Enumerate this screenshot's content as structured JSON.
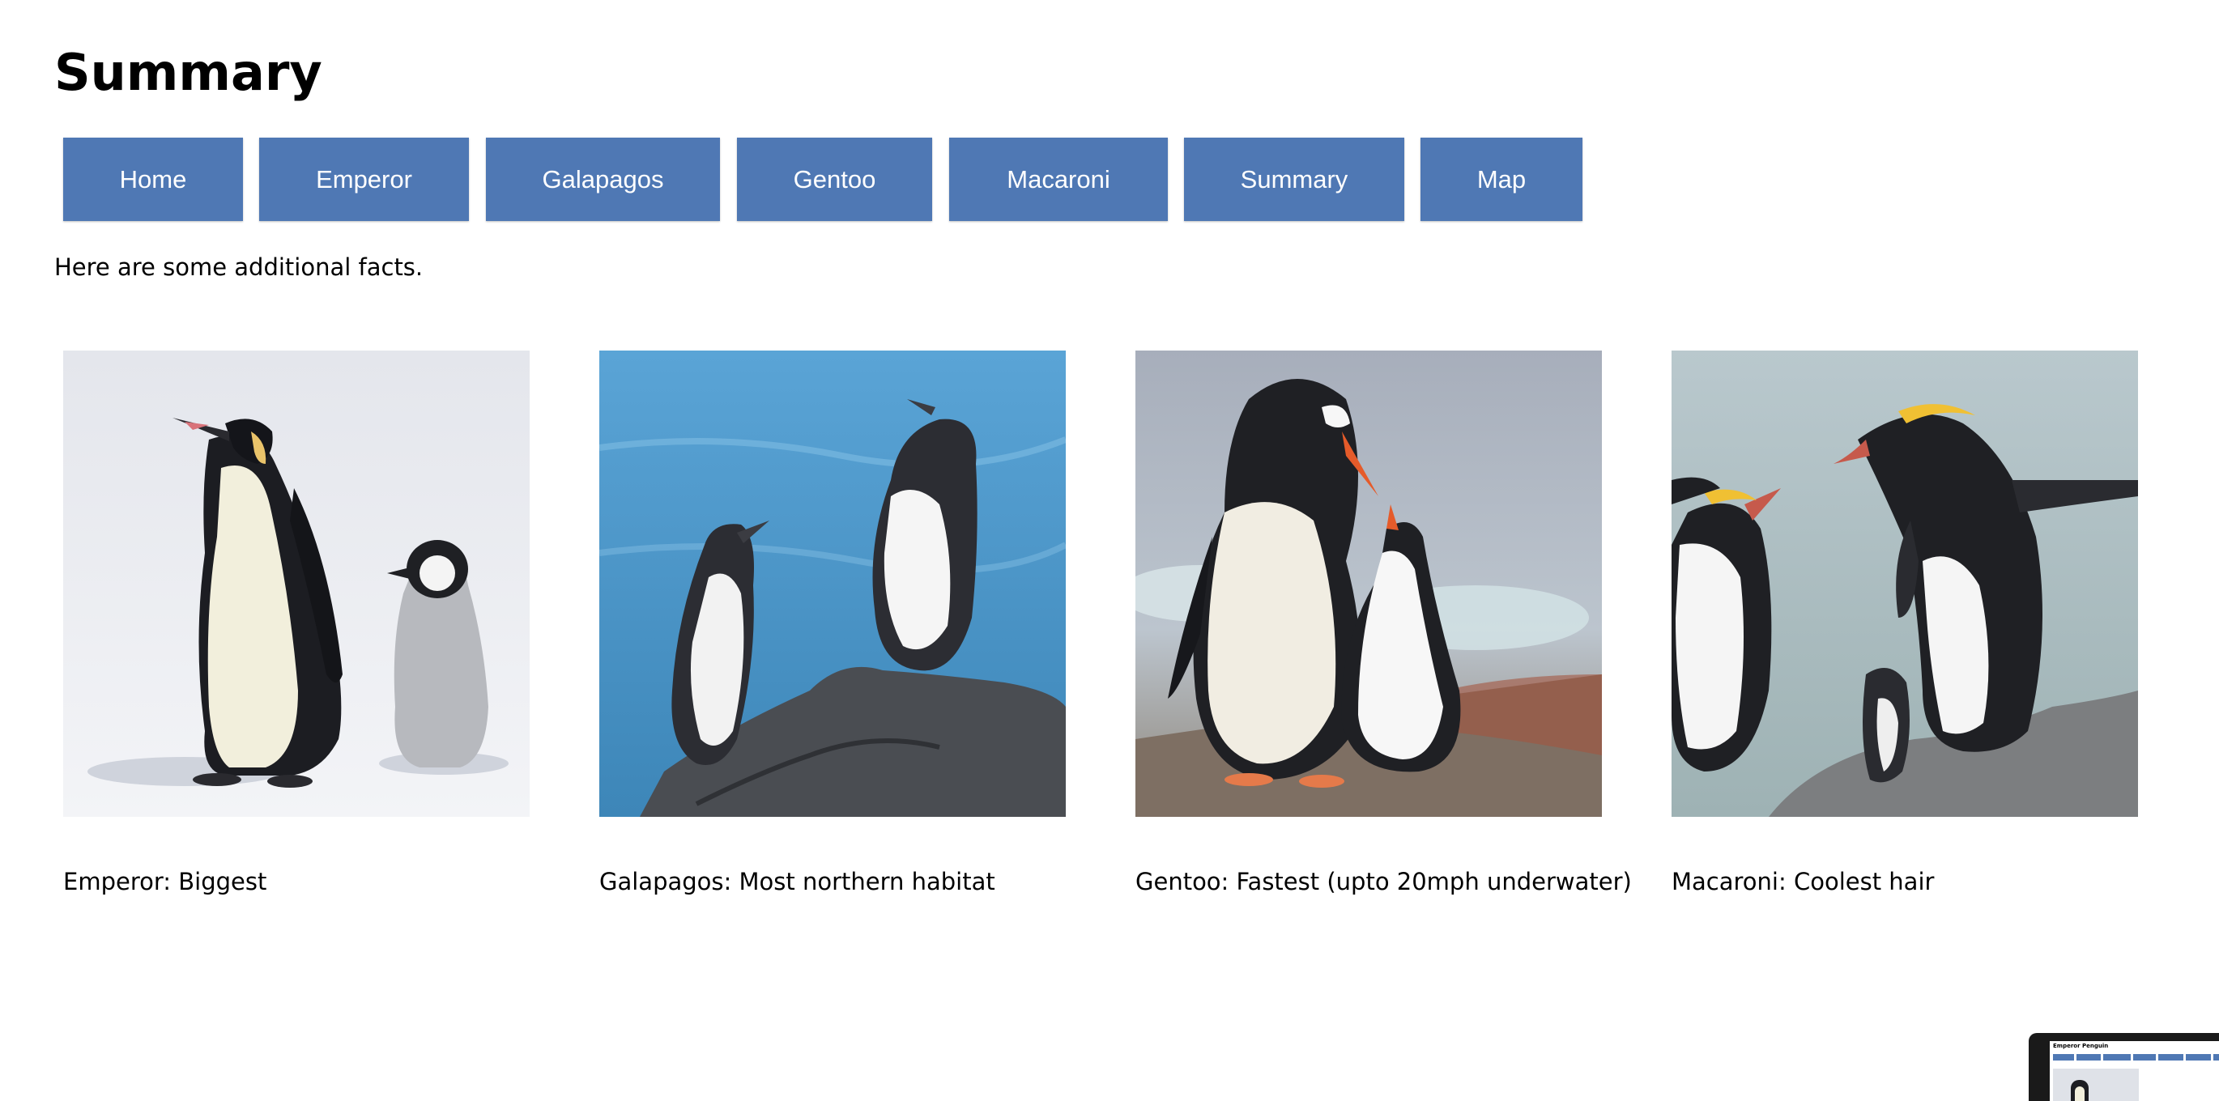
{
  "page": {
    "title": "Summary",
    "intro": "Here are some additional facts."
  },
  "nav": {
    "items": [
      {
        "label": "Home"
      },
      {
        "label": "Emperor"
      },
      {
        "label": "Galapagos"
      },
      {
        "label": "Gentoo"
      },
      {
        "label": "Macaroni"
      },
      {
        "label": "Summary"
      },
      {
        "label": "Map"
      }
    ]
  },
  "facts": [
    {
      "caption": "Emperor: Biggest"
    },
    {
      "caption": "Galapagos: Most northern habitat"
    },
    {
      "caption": "Gentoo: Fastest (upto 20mph underwater)"
    },
    {
      "caption": "Macaroni: Coolest hair"
    }
  ],
  "thumbnail": {
    "title": "Emperor Penguin"
  },
  "colors": {
    "nav_button": "#4f78b4",
    "nav_text": "#ffffff"
  }
}
